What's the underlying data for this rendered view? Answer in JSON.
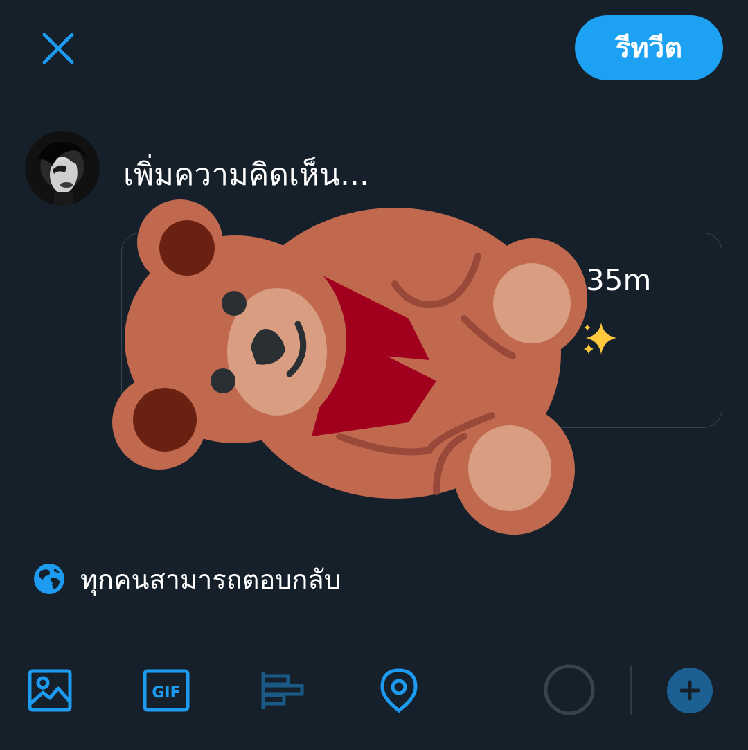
{
  "header": {
    "close_icon": "close-icon",
    "retweet_label": "รีทวีต",
    "accent": "#1da1f2"
  },
  "composer": {
    "placeholder": "เพิ่มความคิดเห็น...",
    "avatar_icon": "avatar-photo"
  },
  "quoted_tweet": {
    "time": "35m",
    "sparkle_icon": "sparkles-icon",
    "sticker_icon": "teddy-bear-icon"
  },
  "reply_setting": {
    "icon": "globe-icon",
    "label": "ทุกคนสามารถตอบกลับ"
  },
  "toolbar": {
    "image_icon": "image-icon",
    "gif_label": "GIF",
    "poll_icon": "poll-icon",
    "location_icon": "location-icon",
    "progress_icon": "character-count-ring",
    "add_icon": "plus-icon"
  },
  "colors": {
    "background": "#15202b",
    "divider": "#38444d",
    "icon_blue": "#1d9bf0",
    "icon_disabled": "#1a5a87"
  }
}
